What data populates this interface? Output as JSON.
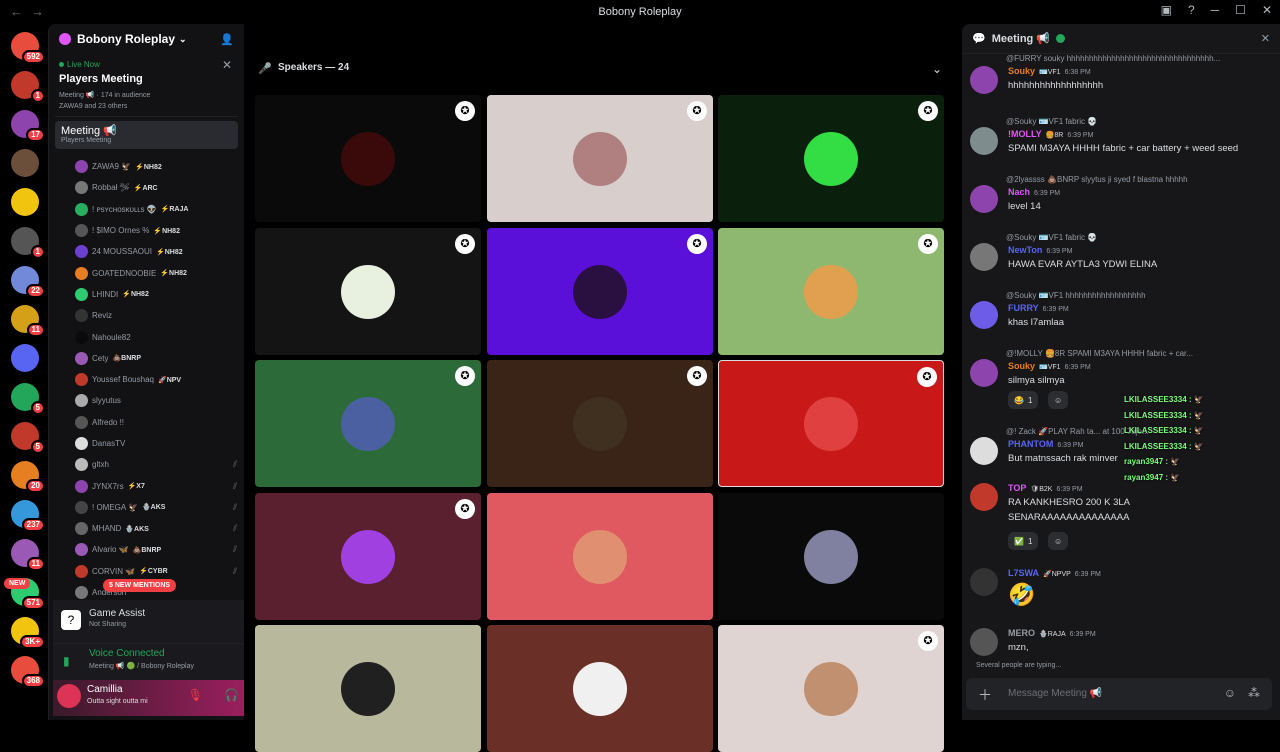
{
  "window": {
    "title": "Bobony Roleplay"
  },
  "servers": [
    {
      "badge": "592",
      "color": "#e74c3c"
    },
    {
      "badge": "1",
      "color": "#c0392b"
    },
    {
      "badge": "17",
      "color": "#8e44ad"
    },
    {
      "badge": "",
      "color": "#6b4f3a"
    },
    {
      "badge": "",
      "color": "#f1c40f"
    },
    {
      "badge": "1",
      "color": "#555"
    },
    {
      "badge": "22",
      "color": "#7289da"
    },
    {
      "badge": "11",
      "color": "#d4a017"
    },
    {
      "badge": "",
      "color": "#5865f2"
    },
    {
      "badge": "5",
      "color": "#23a55a"
    },
    {
      "badge": "5",
      "color": "#c0392b"
    },
    {
      "badge": "20",
      "color": "#e67e22"
    },
    {
      "badge": "237",
      "color": "#3498db"
    },
    {
      "badge": "11",
      "color": "#9b59b6"
    },
    {
      "badge": "571",
      "color": "#2ecc71"
    },
    {
      "badge": "3K+",
      "color": "#f1c40f"
    },
    {
      "badge": "368",
      "color": "#e74c3c"
    }
  ],
  "new_label": "NEW",
  "guild": {
    "name": "Bobony Roleplay"
  },
  "live": {
    "label": "Live Now",
    "title": "Players Meeting",
    "channel": "Meeting 📢",
    "audience": "174 in audience",
    "speakers_line": "ZAWA9 and 23 others"
  },
  "voice_channel": {
    "name": "Meeting 📢",
    "sub": "Players Meeting"
  },
  "members": [
    {
      "name": "ZAWA9 🦅",
      "tag": "⚡NH82",
      "color": "#8e44ad",
      "muted": false
    },
    {
      "name": "Robbał 🛩",
      "tag": "⚡ARC",
      "color": "#777",
      "muted": false
    },
    {
      "name": "! ᴘsʏᴄʜᴏsᴋᴜʟʟs 👽",
      "tag": "⚡RAJA",
      "color": "#27ae60",
      "muted": false
    },
    {
      "name": "! $IMO Ornes %",
      "tag": "⚡NH82",
      "color": "#555",
      "muted": false
    },
    {
      "name": "24 MOUSSAOUI",
      "tag": "⚡NH82",
      "color": "#6c3fd0",
      "muted": false
    },
    {
      "name": "GOATEDNOOBIE",
      "tag": "⚡NH82",
      "color": "#e67e22",
      "muted": false
    },
    {
      "name": "LHINDI",
      "tag": "⚡NH82",
      "color": "#2ecc71",
      "muted": false
    },
    {
      "name": "Reviz",
      "tag": "",
      "color": "#333",
      "muted": false
    },
    {
      "name": "Nahoule82",
      "tag": "",
      "color": "#0a0a0a",
      "muted": false
    },
    {
      "name": "Cety",
      "tag": "💩BNRP",
      "color": "#9b59b6",
      "muted": false
    },
    {
      "name": "Youssef Boushaq",
      "tag": "🚀NPV",
      "color": "#c0392b",
      "muted": false
    },
    {
      "name": "slyyutus",
      "tag": "",
      "color": "#aaa",
      "muted": false
    },
    {
      "name": "Alfredo !!",
      "tag": "",
      "color": "#555",
      "muted": false
    },
    {
      "name": "DanasTV",
      "tag": "",
      "color": "#ddd",
      "muted": false
    },
    {
      "name": "gltxh",
      "tag": "",
      "color": "#bbb",
      "muted": true
    },
    {
      "name": "JYNX7rs",
      "tag": "⚡X7",
      "color": "#8e44ad",
      "muted": true
    },
    {
      "name": "! OMEGA 🦅",
      "tag": "🪬AKS",
      "color": "#444",
      "muted": true
    },
    {
      "name": "MHAND",
      "tag": "🪬AKS",
      "color": "#666",
      "muted": true
    },
    {
      "name": "Alvario 🦋",
      "tag": "💩BNRP",
      "color": "#9b59b6",
      "muted": true
    },
    {
      "name": "CORVIN 🦋",
      "tag": "⚡CYBR",
      "color": "#c0392b",
      "muted": true
    },
    {
      "name": "Anderson",
      "tag": "",
      "color": "#777",
      "muted": false
    }
  ],
  "mentions_label": "5 NEW MENTIONS",
  "game_assist": {
    "title": "Game Assist",
    "sub": "Not Sharing"
  },
  "voice_connected": {
    "title": "Voice Connected",
    "sub": "Meeting 📢 🟢 / Bobony Roleplay"
  },
  "user": {
    "name": "Camillia",
    "status": "Outta sight outta mi"
  },
  "stage": {
    "speakers_label": "Speakers — 24"
  },
  "tiles": [
    {
      "bg": "#0a0a0a",
      "av": "#3a0a0a",
      "badge": true
    },
    {
      "bg": "#d8cfcc",
      "av": "#b08080",
      "badge": true
    },
    {
      "bg": "#0b1f0d",
      "av": "#33dd44",
      "badge": true
    },
    {
      "bg": "#141414",
      "av": "#e8f0e0",
      "badge": true
    },
    {
      "bg": "#5a10d8",
      "av": "#2a1040",
      "badge": true
    },
    {
      "bg": "#8eb870",
      "av": "#e0a050",
      "badge": true
    },
    {
      "bg": "#2c6a3a",
      "av": "#4a60a0",
      "badge": true
    },
    {
      "bg": "#3a2418",
      "av": "#403020",
      "badge": true
    },
    {
      "bg": "#c81818",
      "av": "#e04040",
      "badge": true
    },
    {
      "bg": "#5a2030",
      "av": "#a040e0",
      "badge": true
    },
    {
      "bg": "#e05860",
      "av": "#e09070",
      "badge": false
    },
    {
      "bg": "#0a0a0a",
      "av": "#8080a0",
      "badge": false
    },
    {
      "bg": "#b8b89c",
      "av": "#202020",
      "badge": false
    },
    {
      "bg": "#6a3028",
      "av": "#f0f0f0",
      "badge": false
    },
    {
      "bg": "#e0d4d2",
      "av": "#c09070",
      "badge": true
    }
  ],
  "chat": {
    "title": "Meeting 📢",
    "top_reply": "@FURRY souky hhhhhhhhhhhhhhhhhhhhhhhhhhhhhhhhh...",
    "messages": [
      {
        "name": "Souky",
        "tag": "🪪VF1",
        "time": "6:38 PM",
        "text": "hhhhhhhhhhhhhhhhhh",
        "reply": "",
        "color": "#e67e22",
        "av": "#8e44ad"
      },
      {
        "name": "!MOLLY",
        "tag": "🍔8R",
        "time": "6:39 PM",
        "text": "SPAMI M3AYA HHHH fabric + car battery + weed seed",
        "reply": "@Souky 🪪VF1 fabric 💀",
        "color": "#e056fd",
        "av": "#7f8c8d"
      },
      {
        "name": "Nach",
        "tag": "",
        "time": "6:39 PM",
        "text": "level 14",
        "reply": "@2lyassss 💩BNRP slyytus ji syed f blastna hhhhh",
        "color": "#e056fd",
        "av": "#8e44ad"
      },
      {
        "name": "NewTon",
        "tag": "",
        "time": "6:39 PM",
        "text": "HAWA EVAR AYTLA3 YDWI ELINA",
        "reply": "@Souky 🪪VF1 fabric 💀",
        "color": "#5865f2",
        "av": "#777"
      },
      {
        "name": "FURRY",
        "tag": "",
        "time": "6:39 PM",
        "text": "khas l7amlaa",
        "reply": "@Souky 🪪VF1 hhhhhhhhhhhhhhhhhh",
        "color": "#5865f2",
        "av": "#6c5ce7"
      },
      {
        "name": "Souky",
        "tag": "🪪VF1",
        "time": "6:39 PM",
        "text": "silmya silmya",
        "reply": "@!MOLLY 🍔8R SPAMI M3AYA HHHH fabric + car...",
        "color": "#e67e22",
        "av": "#8e44ad"
      },
      {
        "name": "PHANTOM",
        "tag": "",
        "time": "6:39 PM",
        "text": "But matnssach rak minver",
        "reply": "@! Zack 🚀PLAY Rah ta... at 100 7aje...",
        "color": "#5865f2",
        "av": "#ddd"
      },
      {
        "name": "TOP",
        "tag": "🛡B2K",
        "time": "6:39 PM",
        "text": "RA KANKHESRO 200 K 3LA",
        "text2": "SENARAAAAAAAAAAAAAA",
        "reply": "",
        "color": "#e056fd",
        "av": "#c0392b"
      },
      {
        "name": "L7SWA",
        "tag": "🚀NPVP",
        "time": "6:39 PM",
        "text": "🤣",
        "reply": "",
        "color": "#5865f2",
        "av": "#333"
      },
      {
        "name": "MERO",
        "tag": "🪬RAJA",
        "time": "6:39 PM",
        "text": "mzn,",
        "reply": "",
        "color": "#949ba4",
        "av": "#555"
      }
    ],
    "reactions": [
      {
        "emoji": "😂",
        "count": "1"
      },
      {
        "emoji": "✅",
        "count": "1"
      }
    ],
    "overlay": [
      "LKILASSEE3334 : 🦅",
      "LKILASSEE3334 : 🦅",
      "LKILASSEE3334 : 🦅",
      "LKILASSEE3334 : 🦅",
      "rayan3947 : 🦅",
      "rayan3947 : 🦅"
    ],
    "typing": "Several people are typing...",
    "composer_placeholder": "Message Meeting 📢"
  }
}
